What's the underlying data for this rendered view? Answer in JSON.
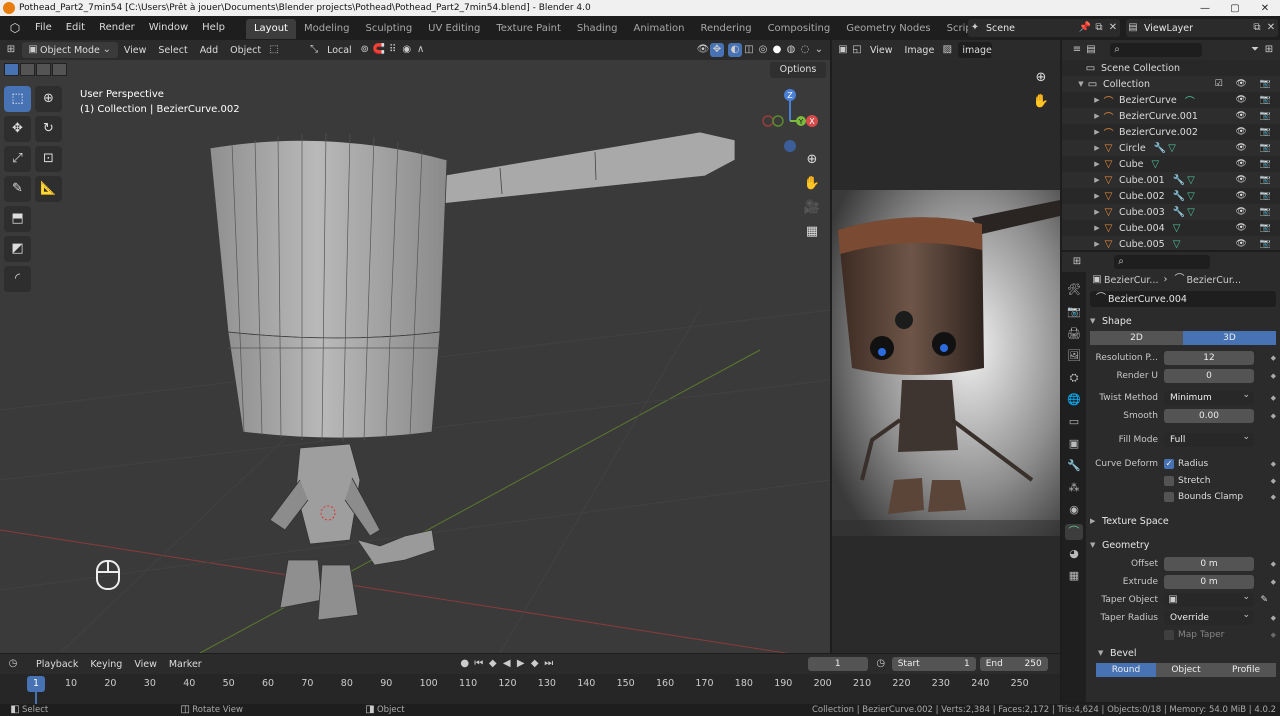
{
  "titlebar": {
    "title": "Pothead_Part2_7min54 [C:\\Users\\Prêt à jouer\\Documents\\Blender projects\\Pothead\\Pothead_Part2_7min54.blend] - Blender 4.0",
    "minimize": "—",
    "maximize": "▢",
    "close": "✕"
  },
  "menu": [
    "File",
    "Edit",
    "Render",
    "Window",
    "Help"
  ],
  "workspaces": [
    "Layout",
    "Modeling",
    "Sculpting",
    "UV Editing",
    "Texture Paint",
    "Shading",
    "Animation",
    "Rendering",
    "Compositing",
    "Geometry Nodes",
    "Scripting"
  ],
  "add_workspace": "+",
  "scene": "Scene",
  "view_layer": "ViewLayer",
  "viewport": {
    "mode": "Object Mode",
    "menus": [
      "View",
      "Select",
      "Add",
      "Object"
    ],
    "orientation": "Local",
    "options": "Options",
    "perspective": "User Perspective",
    "collection_info": "(1) Collection | BezierCurve.002",
    "gizmo": {
      "z": "Z",
      "y": "Y",
      "x": "X"
    }
  },
  "image_editor": {
    "menus": [
      "View",
      "Image"
    ],
    "image_name": "image_"
  },
  "outliner": {
    "root": "Scene Collection",
    "collection": "Collection",
    "items": [
      {
        "name": "BezierCurve",
        "icon": "curve-icon",
        "mods": "⌒"
      },
      {
        "name": "BezierCurve.001",
        "icon": "curve-icon",
        "mods": ""
      },
      {
        "name": "BezierCurve.002",
        "icon": "curve-icon",
        "mods": ""
      },
      {
        "name": "Circle",
        "icon": "mesh-icon",
        "mods": "🔧▽"
      },
      {
        "name": "Cube",
        "icon": "mesh-icon",
        "mods": "▽"
      },
      {
        "name": "Cube.001",
        "icon": "mesh-icon",
        "mods": "🔧▽"
      },
      {
        "name": "Cube.002",
        "icon": "mesh-icon",
        "mods": "🔧▽"
      },
      {
        "name": "Cube.003",
        "icon": "mesh-icon",
        "mods": "🔧▽"
      },
      {
        "name": "Cube.004",
        "icon": "mesh-icon",
        "mods": "▽"
      },
      {
        "name": "Cube.005",
        "icon": "mesh-icon",
        "mods": "▽"
      }
    ]
  },
  "properties": {
    "breadcrumb_obj": "BezierCur...",
    "breadcrumb_data": "BezierCur...",
    "data_name": "BezierCurve.004",
    "shape_panel": "Shape",
    "dim_2d": "2D",
    "dim_3d": "3D",
    "resolution_label": "Resolution P...",
    "resolution_value": "12",
    "render_u_label": "Render U",
    "render_u_value": "0",
    "twist_method_label": "Twist Method",
    "twist_method_value": "Minimum",
    "smooth_label": "Smooth",
    "smooth_value": "0.00",
    "fill_mode_label": "Fill Mode",
    "fill_mode_value": "Full",
    "curve_deform_label": "Curve Deform",
    "radius": "Radius",
    "stretch": "Stretch",
    "bounds_clamp": "Bounds Clamp",
    "texture_space": "Texture Space",
    "geometry": "Geometry",
    "offset_label": "Offset",
    "offset_value": "0 m",
    "extrude_label": "Extrude",
    "extrude_value": "0 m",
    "taper_object_label": "Taper Object",
    "taper_radius_label": "Taper Radius",
    "taper_radius_value": "Override",
    "map_taper": "Map Taper",
    "bevel": "Bevel",
    "bevel_tabs": [
      "Round",
      "Object",
      "Profile"
    ]
  },
  "timeline": {
    "menus": [
      "Playback",
      "Keying",
      "View",
      "Marker"
    ],
    "current_frame": "1",
    "start_label": "Start",
    "start_value": "1",
    "end_label": "End",
    "end_value": "250",
    "ruler": [
      "10",
      "20",
      "30",
      "40",
      "50",
      "60",
      "70",
      "80",
      "90",
      "100",
      "110",
      "120",
      "130",
      "140",
      "150",
      "160",
      "170",
      "180",
      "190",
      "200",
      "210",
      "220",
      "230",
      "240",
      "250"
    ],
    "playhead": "1"
  },
  "statusbar": {
    "select": "Select",
    "rotate": "Rotate View",
    "object": "Object",
    "stats": "Collection | BezierCurve.002 | Verts:2,384 | Faces:2,172 | Tris:4,624 | Objects:0/18 | Memory: 54.0 MiB | 4.0.2"
  }
}
